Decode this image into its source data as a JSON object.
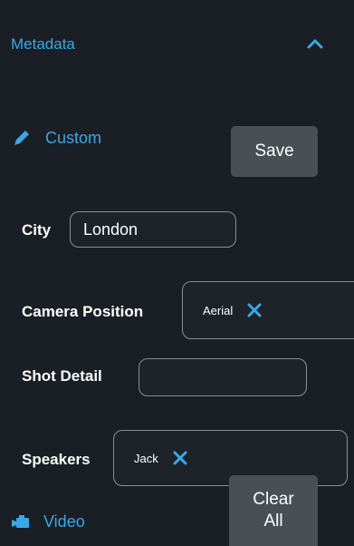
{
  "section": {
    "title": "Metadata"
  },
  "custom": {
    "label": "Custom",
    "save_label": "Save"
  },
  "fields": {
    "city": {
      "label": "City",
      "value": "London"
    },
    "camera_position": {
      "label": "Camera Position",
      "chip": "Aerial"
    },
    "shot_detail": {
      "label": "Shot Detail",
      "value": ""
    },
    "speakers": {
      "label": "Speakers",
      "chip": "Jack"
    }
  },
  "video": {
    "label": "Video",
    "clear_label_line1": "Clear",
    "clear_label_line2": "All"
  },
  "colors": {
    "accent": "#3aa7e6",
    "background": "#1a1f26",
    "button": "#4a4f56",
    "field_border": "#8a8f96"
  },
  "icons": [
    "chevron-up-icon",
    "pencil-icon",
    "close-icon",
    "video-camera-icon"
  ]
}
